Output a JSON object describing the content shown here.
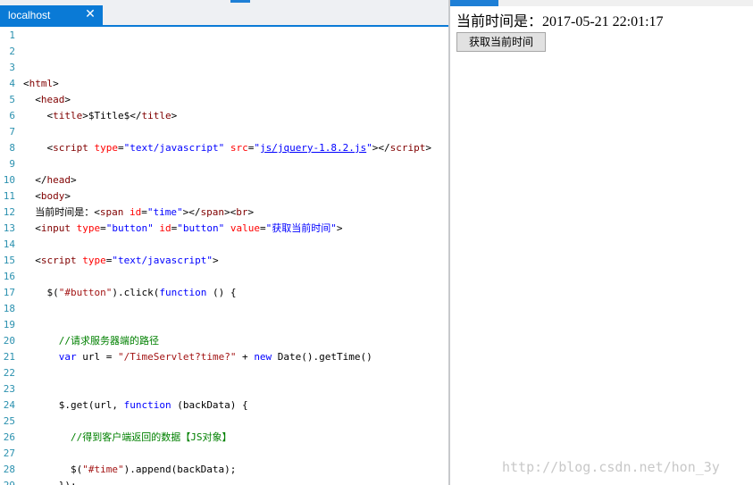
{
  "editor": {
    "tab": {
      "title": "localhost",
      "close_glyph": "✕",
      "close_icon": "close-icon"
    },
    "lines": [
      {
        "n": "1",
        "segs": []
      },
      {
        "n": "2",
        "segs": []
      },
      {
        "n": "3",
        "segs": []
      },
      {
        "n": "4",
        "segs": [
          {
            "c": "k-plain",
            "t": "<"
          },
          {
            "c": "k-tag",
            "t": "html"
          },
          {
            "c": "k-plain",
            "t": ">"
          }
        ]
      },
      {
        "n": "5",
        "segs": [
          {
            "c": "k-plain",
            "t": "  <"
          },
          {
            "c": "k-tag",
            "t": "head"
          },
          {
            "c": "k-plain",
            "t": ">"
          }
        ]
      },
      {
        "n": "6",
        "segs": [
          {
            "c": "k-plain",
            "t": "    <"
          },
          {
            "c": "k-tag",
            "t": "title"
          },
          {
            "c": "k-plain",
            "t": ">$Title$</"
          },
          {
            "c": "k-tag",
            "t": "title"
          },
          {
            "c": "k-plain",
            "t": ">"
          }
        ]
      },
      {
        "n": "7",
        "segs": []
      },
      {
        "n": "8",
        "segs": [
          {
            "c": "k-plain",
            "t": "    <"
          },
          {
            "c": "k-tag",
            "t": "script "
          },
          {
            "c": "k-attr",
            "t": "type"
          },
          {
            "c": "k-plain",
            "t": "="
          },
          {
            "c": "k-val",
            "t": "\"text/javascript\""
          },
          {
            "c": "k-plain",
            "t": " "
          },
          {
            "c": "k-attr",
            "t": "src"
          },
          {
            "c": "k-plain",
            "t": "="
          },
          {
            "c": "k-val",
            "t": "\""
          },
          {
            "c": "k-link",
            "t": "js/jquery-1.8.2.js"
          },
          {
            "c": "k-val",
            "t": "\""
          },
          {
            "c": "k-plain",
            "t": "></"
          },
          {
            "c": "k-tag",
            "t": "script"
          },
          {
            "c": "k-plain",
            "t": ">"
          }
        ]
      },
      {
        "n": "9",
        "segs": []
      },
      {
        "n": "10",
        "segs": [
          {
            "c": "k-plain",
            "t": "  </"
          },
          {
            "c": "k-tag",
            "t": "head"
          },
          {
            "c": "k-plain",
            "t": ">"
          }
        ]
      },
      {
        "n": "11",
        "segs": [
          {
            "c": "k-plain",
            "t": "  <"
          },
          {
            "c": "k-tag",
            "t": "body"
          },
          {
            "c": "k-plain",
            "t": ">"
          }
        ]
      },
      {
        "n": "12",
        "segs": [
          {
            "c": "k-plain",
            "t": "  当前时间是：<"
          },
          {
            "c": "k-tag",
            "t": "span "
          },
          {
            "c": "k-attr",
            "t": "id"
          },
          {
            "c": "k-plain",
            "t": "="
          },
          {
            "c": "k-val",
            "t": "\"time\""
          },
          {
            "c": "k-plain",
            "t": "></"
          },
          {
            "c": "k-tag",
            "t": "span"
          },
          {
            "c": "k-plain",
            "t": "><"
          },
          {
            "c": "k-tag",
            "t": "br"
          },
          {
            "c": "k-plain",
            "t": ">"
          }
        ]
      },
      {
        "n": "13",
        "segs": [
          {
            "c": "k-plain",
            "t": "  <"
          },
          {
            "c": "k-tag",
            "t": "input "
          },
          {
            "c": "k-attr",
            "t": "type"
          },
          {
            "c": "k-plain",
            "t": "="
          },
          {
            "c": "k-val",
            "t": "\"button\""
          },
          {
            "c": "k-plain",
            "t": " "
          },
          {
            "c": "k-attr",
            "t": "id"
          },
          {
            "c": "k-plain",
            "t": "="
          },
          {
            "c": "k-val",
            "t": "\"button\""
          },
          {
            "c": "k-plain",
            "t": " "
          },
          {
            "c": "k-attr",
            "t": "value"
          },
          {
            "c": "k-plain",
            "t": "="
          },
          {
            "c": "k-val",
            "t": "\"获取当前时间\""
          },
          {
            "c": "k-plain",
            "t": ">"
          }
        ]
      },
      {
        "n": "14",
        "segs": []
      },
      {
        "n": "15",
        "segs": [
          {
            "c": "k-plain",
            "t": "  <"
          },
          {
            "c": "k-tag",
            "t": "script "
          },
          {
            "c": "k-attr",
            "t": "type"
          },
          {
            "c": "k-plain",
            "t": "="
          },
          {
            "c": "k-val",
            "t": "\"text/javascript\""
          },
          {
            "c": "k-plain",
            "t": ">"
          }
        ]
      },
      {
        "n": "16",
        "segs": []
      },
      {
        "n": "17",
        "segs": [
          {
            "c": "k-plain",
            "t": "    $("
          },
          {
            "c": "k-str",
            "t": "\"#button\""
          },
          {
            "c": "k-plain",
            "t": ").click("
          },
          {
            "c": "k-kw",
            "t": "function"
          },
          {
            "c": "k-plain",
            "t": " () {"
          }
        ]
      },
      {
        "n": "18",
        "segs": []
      },
      {
        "n": "19",
        "segs": []
      },
      {
        "n": "20",
        "segs": [
          {
            "c": "k-com",
            "t": "      //请求服务器端的路径"
          }
        ]
      },
      {
        "n": "21",
        "segs": [
          {
            "c": "k-plain",
            "t": "      "
          },
          {
            "c": "k-kw",
            "t": "var"
          },
          {
            "c": "k-plain",
            "t": " url = "
          },
          {
            "c": "k-str",
            "t": "\"/TimeServlet?time?\""
          },
          {
            "c": "k-plain",
            "t": " + "
          },
          {
            "c": "k-kw",
            "t": "new"
          },
          {
            "c": "k-plain",
            "t": " Date().getTime()"
          }
        ]
      },
      {
        "n": "22",
        "segs": []
      },
      {
        "n": "23",
        "segs": []
      },
      {
        "n": "24",
        "segs": [
          {
            "c": "k-plain",
            "t": "      $.get(url, "
          },
          {
            "c": "k-kw",
            "t": "function"
          },
          {
            "c": "k-plain",
            "t": " (backData) {"
          }
        ]
      },
      {
        "n": "25",
        "segs": []
      },
      {
        "n": "26",
        "segs": [
          {
            "c": "k-com",
            "t": "        //得到客户端返回的数据【JS对象】"
          }
        ]
      },
      {
        "n": "27",
        "segs": []
      },
      {
        "n": "28",
        "segs": [
          {
            "c": "k-plain",
            "t": "        $("
          },
          {
            "c": "k-str",
            "t": "\"#time\""
          },
          {
            "c": "k-plain",
            "t": ").append(backData);"
          }
        ]
      },
      {
        "n": "29",
        "segs": [
          {
            "c": "k-plain",
            "t": "      });"
          }
        ]
      }
    ]
  },
  "preview": {
    "time_text": "当前时间是：2017-05-21 22:01:17",
    "button_label": "获取当前时间"
  },
  "watermark": "http://blog.csdn.net/hon_3y",
  "colors": {
    "accent": "#0a7ad6",
    "line_number": "#2b91af",
    "tag": "#800000",
    "attr": "#ff0000",
    "value": "#0000ff",
    "comment": "#008000"
  }
}
